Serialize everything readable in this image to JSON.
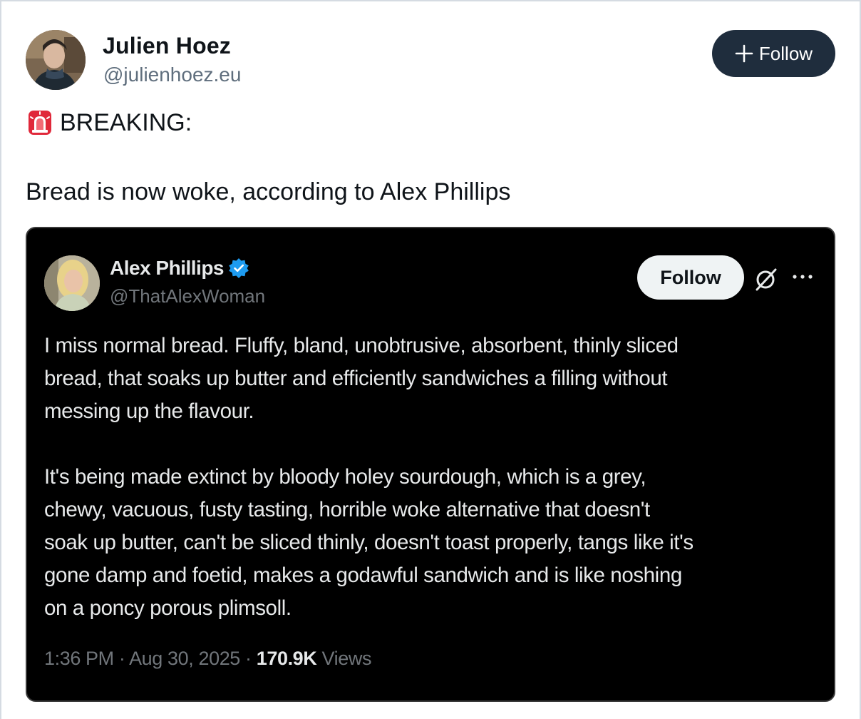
{
  "author": {
    "name": "Julien Hoez",
    "handle": "@julienhoez.eu"
  },
  "follow_button": {
    "label": "Follow",
    "icon": "plus-icon"
  },
  "post": {
    "breaking_icon": "siren-icon",
    "breaking_label": "BREAKING:",
    "text": "Bread is now woke, according to Alex Phillips"
  },
  "embedded_tweet": {
    "author_name": "Alex Phillips",
    "verified_icon": "verified-badge-icon",
    "handle": "@ThatAlexWoman",
    "follow_label": "Follow",
    "grok_icon": "grok-icon",
    "more_icon": "more-icon",
    "body_lines_p1": [
      "I miss normal bread. Fluffy, bland, unobtrusive, absorbent, thinly sliced",
      "bread, that soaks up butter and efficiently sandwiches a filling without",
      "messing up the flavour."
    ],
    "body_lines_p2": [
      "It's being made extinct by bloody holey sourdough, which is a grey,",
      "chewy, vacuous, fusty tasting, horrible woke alternative that doesn't",
      "soak up butter, can't be sliced thinly, doesn't toast properly, tangs like it's",
      "gone damp and foetid, makes a godawful sandwich and is like noshing",
      "on a poncy porous plimsoll."
    ],
    "time": "1:36 PM",
    "date": "Aug 30, 2025",
    "views_count": "170.9K",
    "views_label": "Views"
  },
  "colors": {
    "follow_button_bg": "#1f2d3d",
    "verified_blue": "#1d9bf0",
    "embed_bg": "#000000"
  }
}
